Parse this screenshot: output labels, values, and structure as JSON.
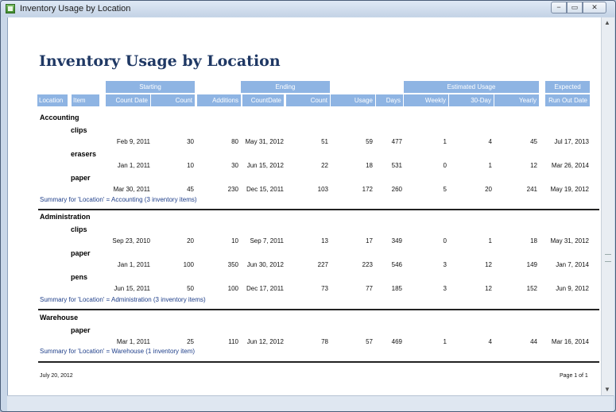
{
  "window": {
    "title": "Inventory Usage by Location",
    "min_glyph": "−",
    "max_glyph": "▭",
    "close_glyph": "✕",
    "scroll_up": "▲",
    "scroll_down": "▼"
  },
  "report": {
    "title": "Inventory Usage by Location",
    "group_headers": {
      "starting": "Starting",
      "ending": "Ending",
      "estimated_usage": "Estimated Usage",
      "expected": "Expected"
    },
    "columns": {
      "location": "Location",
      "item": "Item",
      "count_date": "Count Date",
      "count": "Count",
      "additions": "Additions",
      "end_count_date": "CountDate",
      "end_count": "Count",
      "usage": "Usage",
      "days": "Days",
      "weekly": "Weekly",
      "thirty_day": "30-Day",
      "yearly": "Yearly",
      "run_out_date": "Run Out Date"
    },
    "groups": [
      {
        "name": "Accounting",
        "rows": [
          {
            "item": "clips",
            "start_date": "Feb 9, 2011",
            "start_count": "30",
            "additions": "80",
            "end_date": "May 31, 2012",
            "end_count": "51",
            "usage": "59",
            "days": "477",
            "weekly": "1",
            "thirty_day": "4",
            "yearly": "45",
            "run_out": "Jul 17, 2013"
          },
          {
            "item": "erasers",
            "start_date": "Jan 1, 2011",
            "start_count": "10",
            "additions": "30",
            "end_date": "Jun 15, 2012",
            "end_count": "22",
            "usage": "18",
            "days": "531",
            "weekly": "0",
            "thirty_day": "1",
            "yearly": "12",
            "run_out": "Mar 26, 2014"
          },
          {
            "item": "paper",
            "start_date": "Mar 30, 2011",
            "start_count": "45",
            "additions": "230",
            "end_date": "Dec 15, 2011",
            "end_count": "103",
            "usage": "172",
            "days": "260",
            "weekly": "5",
            "thirty_day": "20",
            "yearly": "241",
            "run_out": "May 19, 2012"
          }
        ],
        "summary": "Summary for 'Location' =  Accounting (3 inventory items)"
      },
      {
        "name": "Administration",
        "rows": [
          {
            "item": "clips",
            "start_date": "Sep 23, 2010",
            "start_count": "20",
            "additions": "10",
            "end_date": "Sep 7, 2011",
            "end_count": "13",
            "usage": "17",
            "days": "349",
            "weekly": "0",
            "thirty_day": "1",
            "yearly": "18",
            "run_out": "May 31, 2012"
          },
          {
            "item": "paper",
            "start_date": "Jan 1, 2011",
            "start_count": "100",
            "additions": "350",
            "end_date": "Jun 30, 2012",
            "end_count": "227",
            "usage": "223",
            "days": "546",
            "weekly": "3",
            "thirty_day": "12",
            "yearly": "149",
            "run_out": "Jan 7, 2014"
          },
          {
            "item": "pens",
            "start_date": "Jun 15, 2011",
            "start_count": "50",
            "additions": "100",
            "end_date": "Dec 17, 2011",
            "end_count": "73",
            "usage": "77",
            "days": "185",
            "weekly": "3",
            "thirty_day": "12",
            "yearly": "152",
            "run_out": "Jun 9, 2012"
          }
        ],
        "summary": "Summary for 'Location' =  Administration (3 inventory items)"
      },
      {
        "name": "Warehouse",
        "rows": [
          {
            "item": "paper",
            "start_date": "Mar 1, 2011",
            "start_count": "25",
            "additions": "110",
            "end_date": "Jun 12, 2012",
            "end_count": "78",
            "usage": "57",
            "days": "469",
            "weekly": "1",
            "thirty_day": "4",
            "yearly": "44",
            "run_out": "Mar 16, 2014"
          }
        ],
        "summary": "Summary for 'Location' =  Warehouse (1 inventory item)"
      }
    ],
    "footer": {
      "date": "July 20, 2012",
      "page": "Page 1 of 1"
    }
  }
}
